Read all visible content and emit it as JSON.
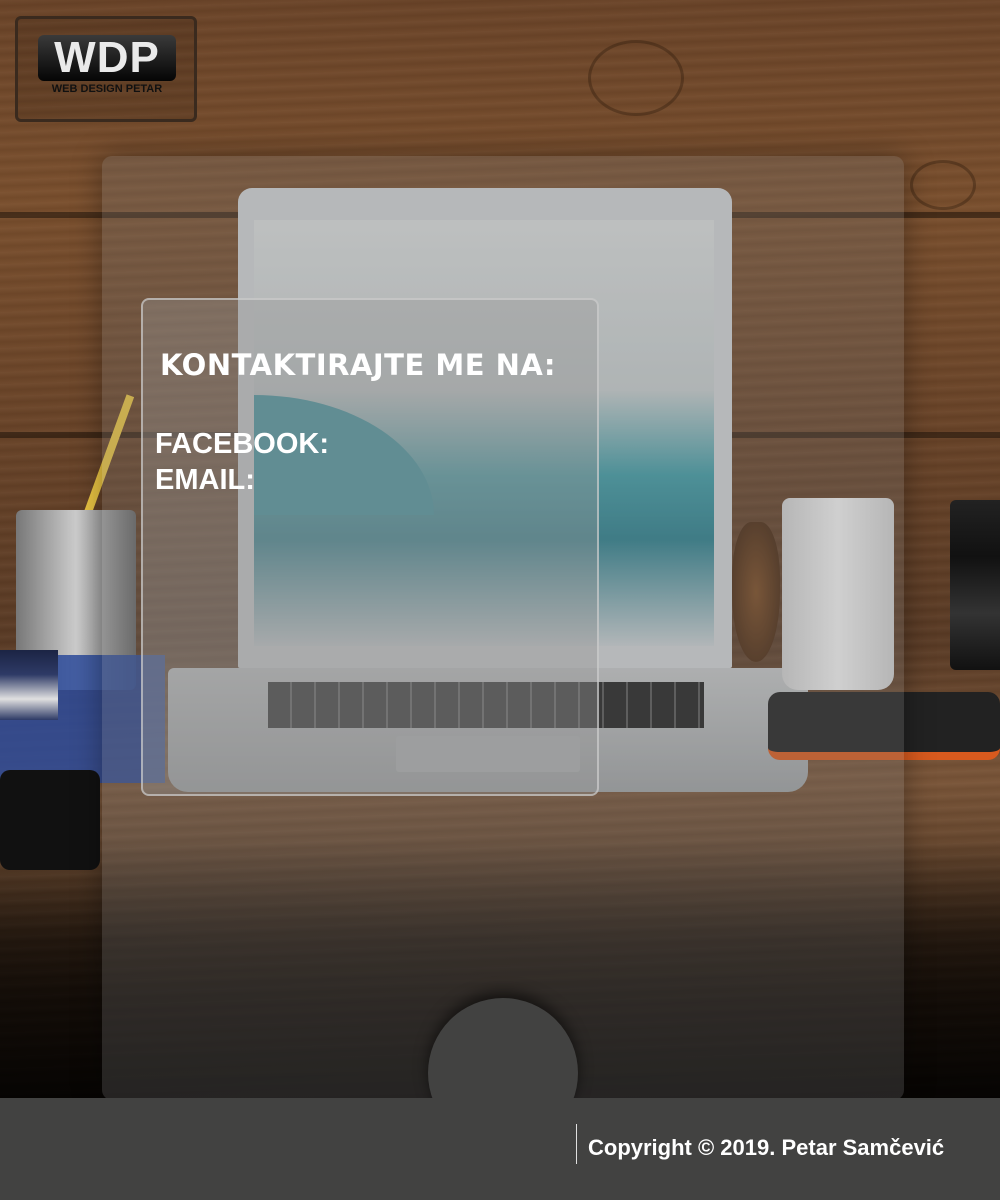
{
  "logo": {
    "mark": "WDP",
    "subtitle": "WEB DESIGN PETAR"
  },
  "contact": {
    "heading": "KONTAKTIRAJTE ME NA:",
    "facebook_label": "FACEBOOK:",
    "email_label": "EMAIL:"
  },
  "footer": {
    "copyright": "Copyright © 2019. Petar Samčević"
  },
  "colors": {
    "footer": "#424241",
    "text": "#ffffff",
    "wood": "#6b4428"
  }
}
